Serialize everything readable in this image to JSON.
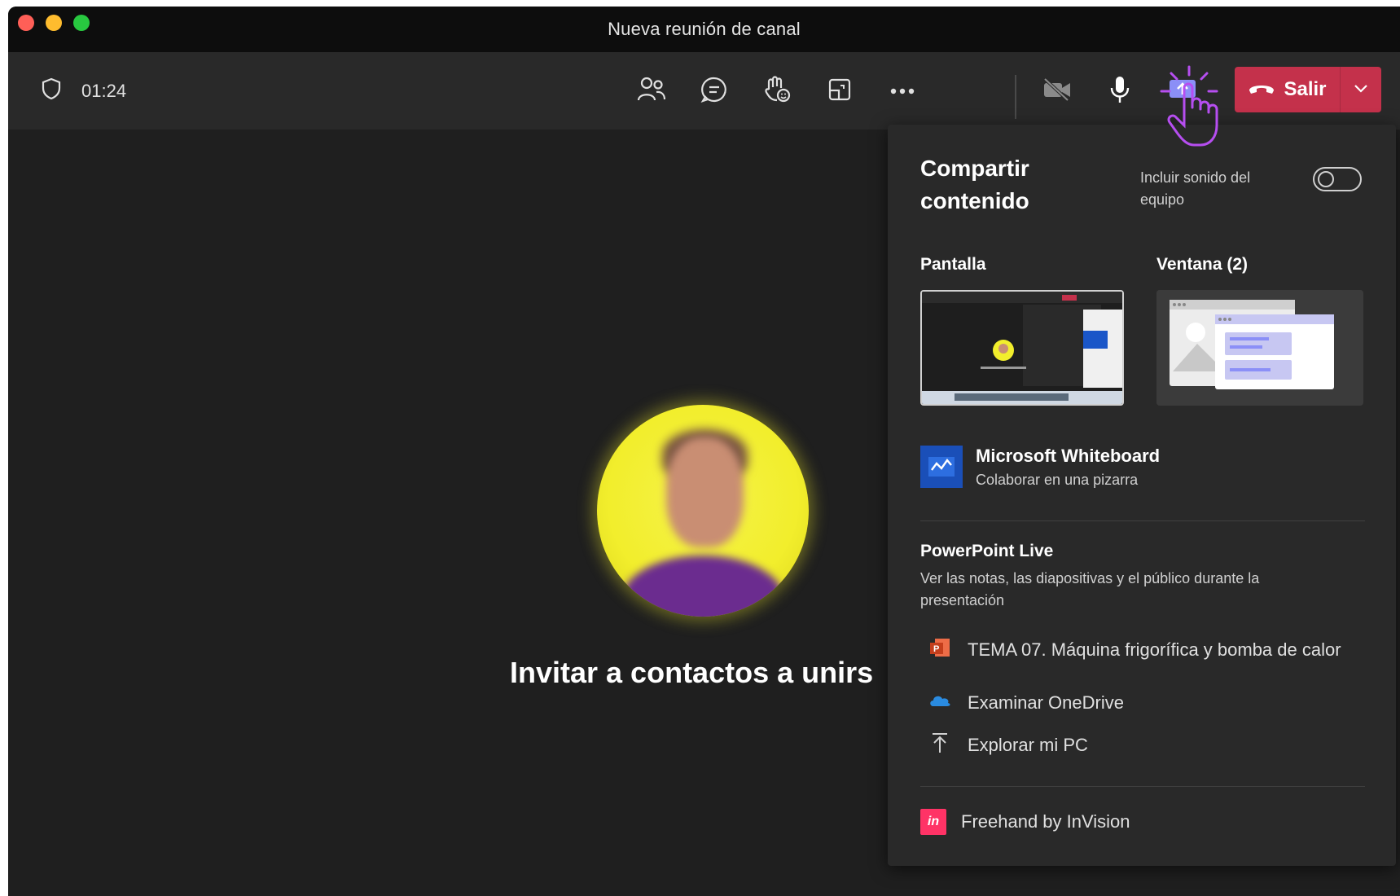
{
  "window": {
    "title": "Nueva reunión de canal"
  },
  "toolbar": {
    "timer": "01:24",
    "leave_label": "Salir",
    "icons": [
      "shield-icon",
      "people-icon",
      "chat-icon",
      "raise-hand-icon",
      "rooms-icon",
      "more-icon",
      "camera-off-icon",
      "microphone-icon",
      "share-screen-icon",
      "phone-hangup-icon",
      "chevron-down-icon"
    ]
  },
  "stage": {
    "invite_text": "Invitar a contactos a unirs"
  },
  "share_panel": {
    "title": "Compartir contenido",
    "system_sound_label": "Incluir sonido del equipo",
    "system_sound_on": false,
    "screen_label": "Pantalla",
    "window_label": "Ventana (2)",
    "whiteboard": {
      "title": "Microsoft Whiteboard",
      "subtitle": "Colaborar en una pizarra"
    },
    "powerpoint": {
      "title": "PowerPoint Live",
      "description": "Ver las notas, las diapositivas y el público durante la presentación",
      "file": "TEMA 07. Máquina frigorífica y bomba de calor"
    },
    "browse_onedrive": "Examinar OneDrive",
    "browse_pc": "Explorar mi PC",
    "freehand": {
      "label": "Freehand by InVision",
      "icon_text": "in"
    }
  },
  "colors": {
    "leave": "#c4314b",
    "accent": "#7f85f5",
    "cursor": "#b64ef0"
  }
}
